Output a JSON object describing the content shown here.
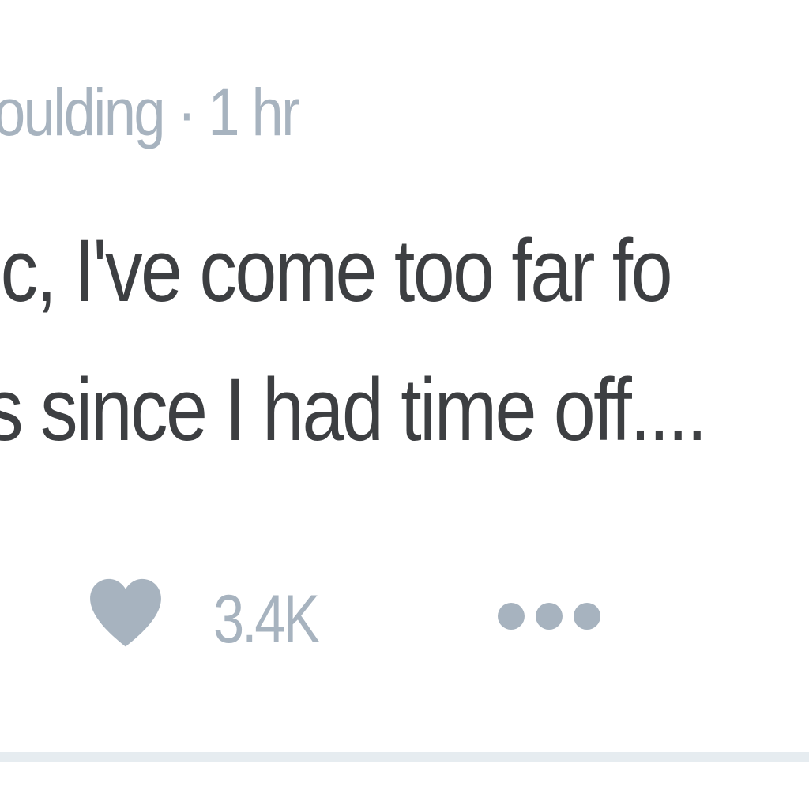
{
  "tweet": {
    "header": {
      "author_fragment": "oulding",
      "separator": "·",
      "timestamp": "1 hr"
    },
    "body_lines": [
      "ic, I've come too far fo",
      "s since I had time off...."
    ],
    "actions": {
      "like_icon": "heart-icon",
      "like_count": "3.4K",
      "more_icon": "more-dots-icon"
    }
  },
  "colors": {
    "background": "#ffffff",
    "body_text": "#3d3f42",
    "muted_text": "#a7b3bf",
    "icon": "#a7b3bf",
    "divider": "#e6ecf0"
  }
}
